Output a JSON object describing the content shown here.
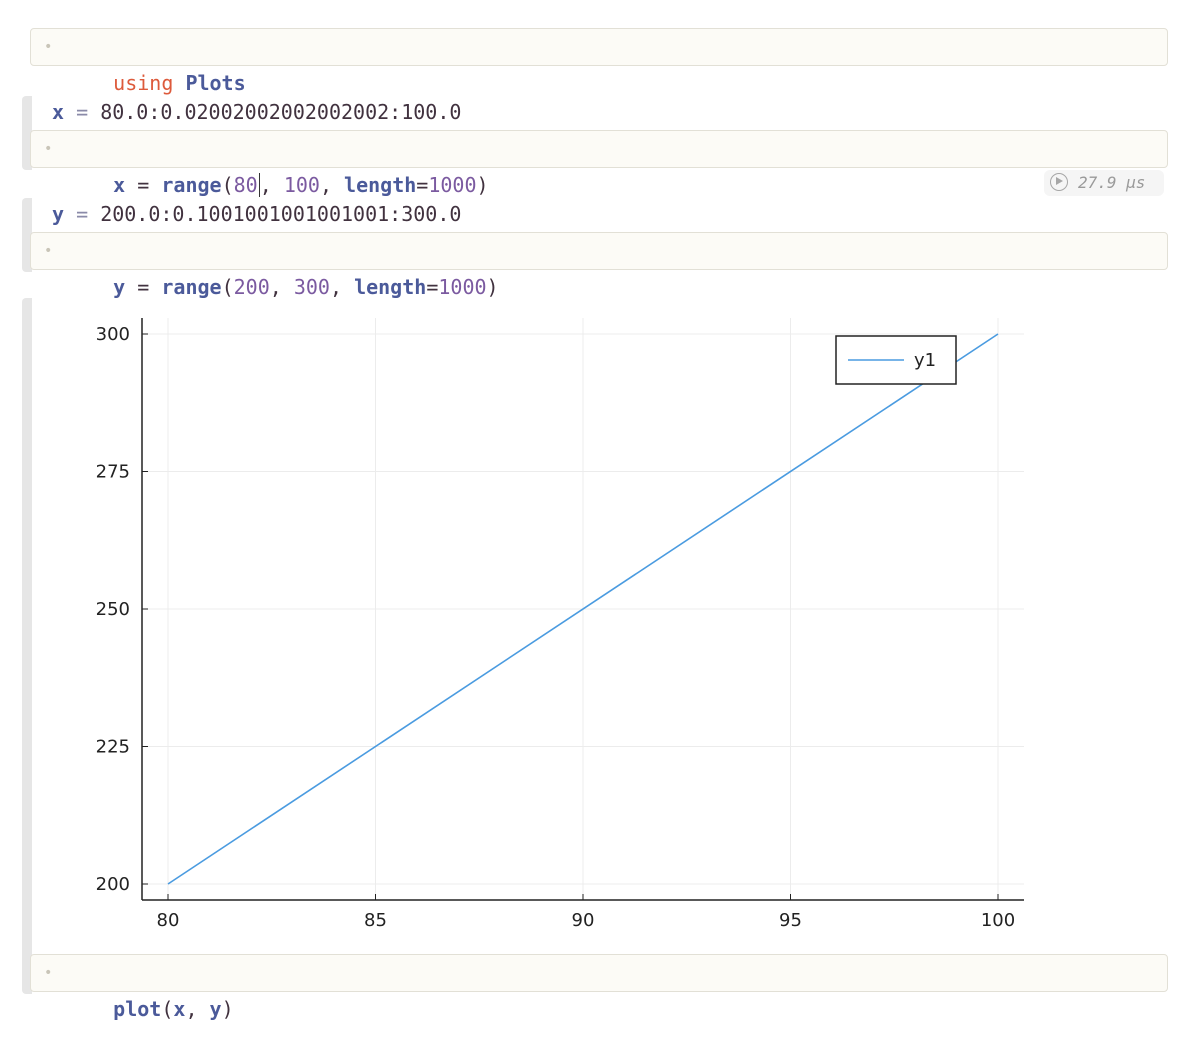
{
  "cells": {
    "using": {
      "keyword": "using",
      "module": "Plots"
    },
    "x": {
      "output_var": "x",
      "output_eq": "=",
      "output_value": "80.0:0.02002002002002002:100.0",
      "code": {
        "var": "x",
        "eq": "=",
        "func": "range",
        "open": "(",
        "arg1": "80",
        "sep1": ", ",
        "arg2": "100",
        "sep2": ", ",
        "kwname": "length",
        "kweq": "=",
        "kwval": "1000",
        "close": ")"
      }
    },
    "runtime": "27.9 μs",
    "y": {
      "output_var": "y",
      "output_eq": "=",
      "output_value": "200.0:0.1001001001001001:300.0",
      "code": {
        "var": "y",
        "eq": "=",
        "func": "range",
        "open": "(",
        "arg1": "200",
        "sep1": ", ",
        "arg2": "300",
        "sep2": ", ",
        "kwname": "length",
        "kweq": "=",
        "kwval": "1000",
        "close": ")"
      }
    },
    "plot": {
      "code": {
        "func": "plot",
        "open": "(",
        "a1": "x",
        "sep": ", ",
        "a2": "y",
        "close": ")"
      }
    }
  },
  "colors": {
    "series": "#4a9be0",
    "keyword": "#dd5a3b",
    "identifier": "#4b5a9a",
    "number": "#7b5aa0"
  },
  "chart_data": {
    "type": "line",
    "series": [
      {
        "name": "y1",
        "x": [
          80,
          100
        ],
        "y": [
          200,
          300
        ]
      }
    ],
    "xlim": [
      80,
      100
    ],
    "ylim": [
      200,
      300
    ],
    "xticks": [
      80,
      85,
      90,
      95,
      100
    ],
    "yticks": [
      200,
      225,
      250,
      275,
      300
    ],
    "grid": true,
    "legend": "top-right",
    "title": "",
    "xlabel": "",
    "ylabel": ""
  }
}
